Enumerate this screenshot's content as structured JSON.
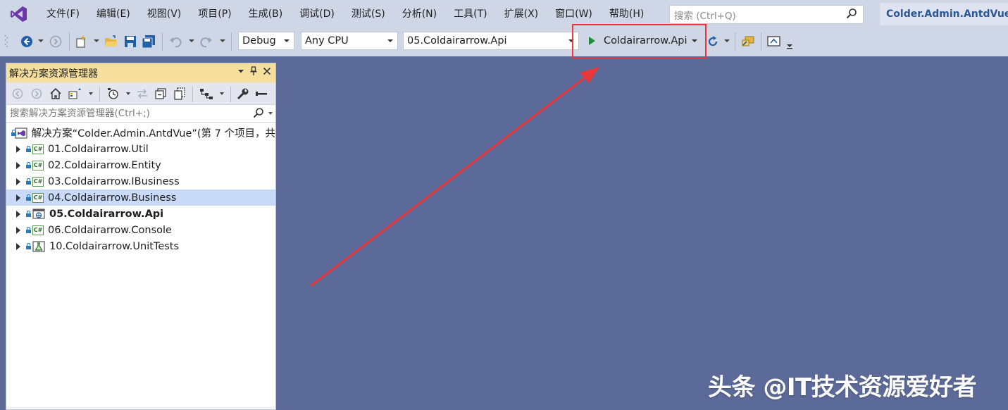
{
  "menubar": {
    "items": [
      "文件(F)",
      "编辑(E)",
      "视图(V)",
      "项目(P)",
      "生成(B)",
      "调试(D)",
      "测试(S)",
      "分析(N)",
      "工具(T)",
      "扩展(X)",
      "窗口(W)",
      "帮助(H)"
    ],
    "search_placeholder": "搜索 (Ctrl+Q)",
    "solution_name": "Colder.Admin.AntdVue"
  },
  "toolbar": {
    "configuration": "Debug",
    "platform": "Any CPU",
    "startup_project": "05.Coldairarrow.Api",
    "run_target": "Coldairarrow.Api",
    "accent_color": "#e8383c",
    "play_color": "#1e8c3a"
  },
  "solution_explorer": {
    "title": "解决方案资源管理器",
    "search_placeholder": "搜索解决方案资源管理器(Ctrl+;)",
    "solution_label": "解决方案“Colder.Admin.AntdVue”(第 7 个项目，共",
    "projects": [
      {
        "name": "01.Coldairarrow.Util",
        "icon": "C#"
      },
      {
        "name": "02.Coldairarrow.Entity",
        "icon": "C#"
      },
      {
        "name": "03.Coldairarrow.IBusiness",
        "icon": "C#"
      },
      {
        "name": "04.Coldairarrow.Business",
        "icon": "C#",
        "selected": true
      },
      {
        "name": "05.Coldairarrow.Api",
        "icon": "web",
        "startup": true
      },
      {
        "name": "06.Coldairarrow.Console",
        "icon": "C#"
      },
      {
        "name": "10.Coldairarrow.UnitTests",
        "icon": "test"
      }
    ]
  },
  "watermark": "头条 @IT技术资源爱好者"
}
